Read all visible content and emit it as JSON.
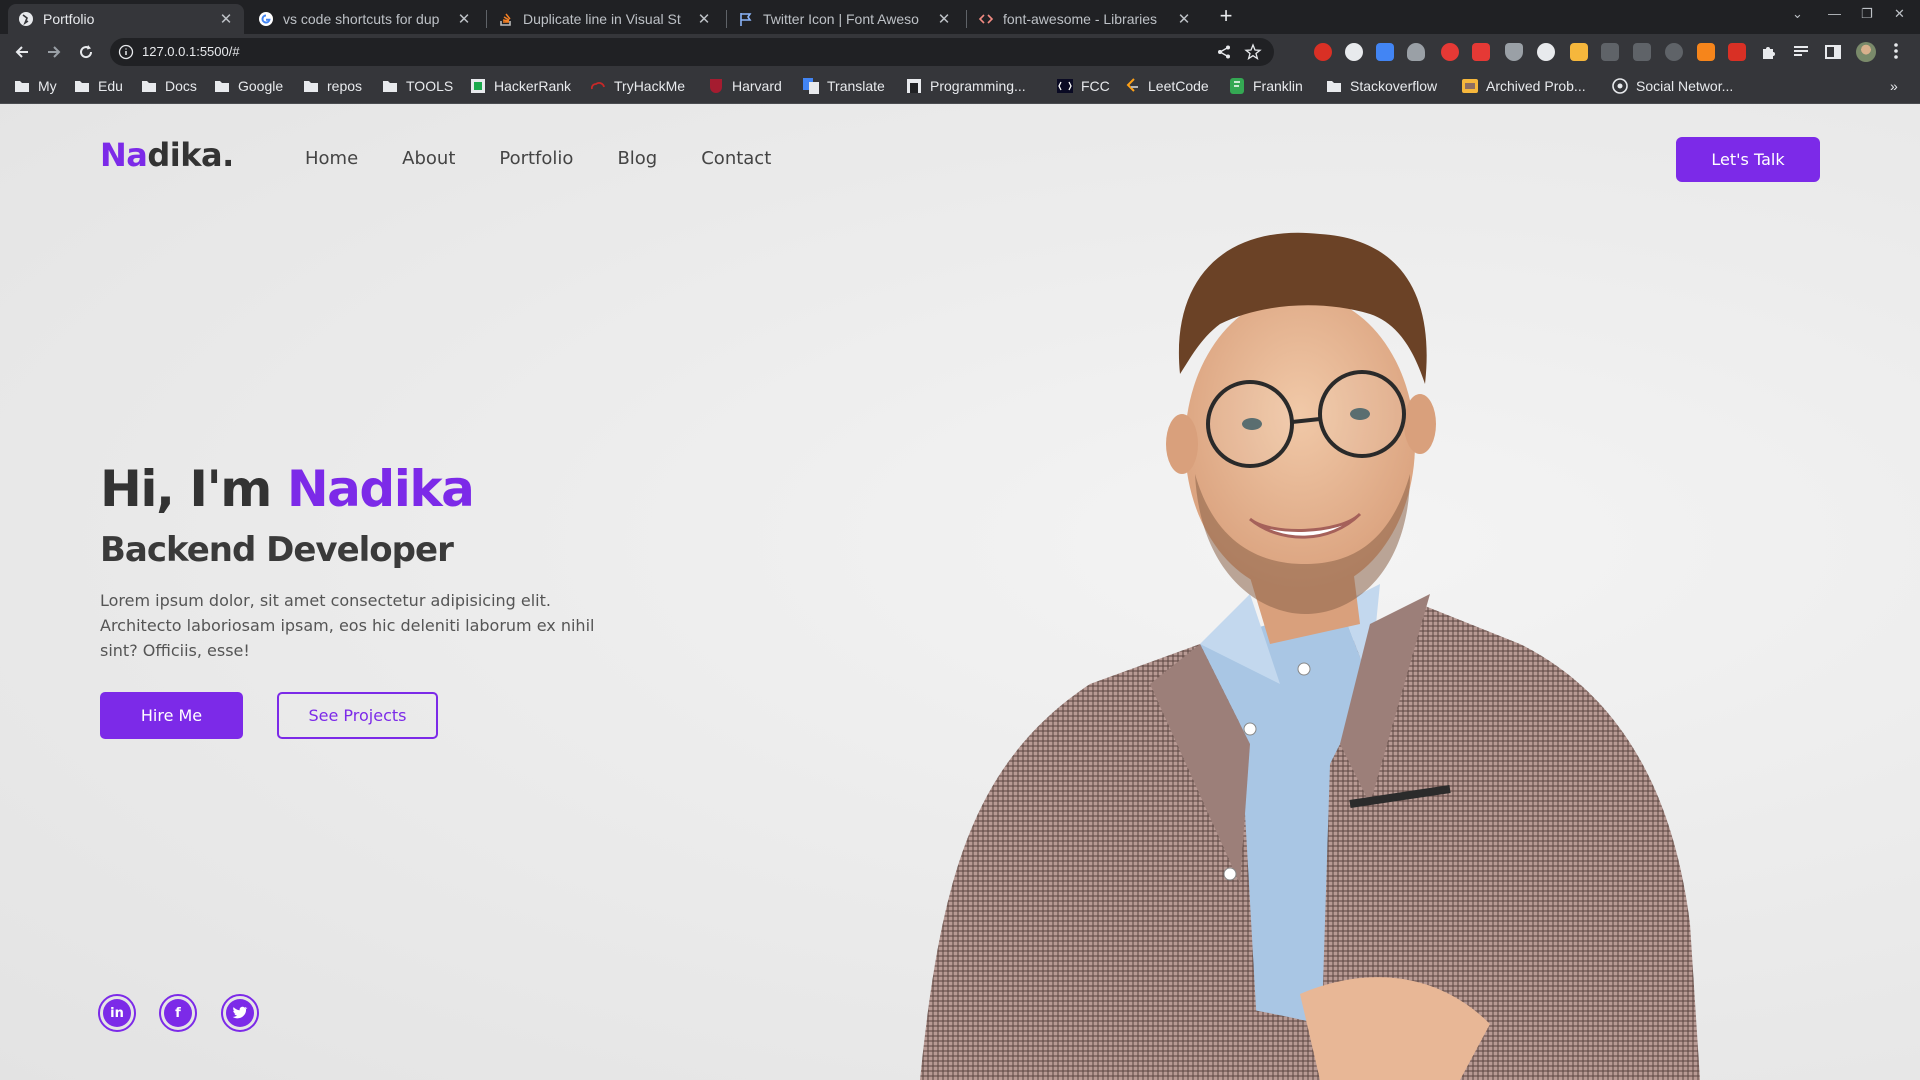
{
  "browser": {
    "tabs": [
      {
        "title": "Portfolio",
        "active": true
      },
      {
        "title": "vs code shortcuts for dup",
        "active": false
      },
      {
        "title": "Duplicate line in Visual St",
        "active": false
      },
      {
        "title": "Twitter Icon | Font Aweso",
        "active": false
      },
      {
        "title": "font-awesome - Libraries",
        "active": false
      }
    ],
    "url": "127.0.0.1:5500/#",
    "bookmarks": [
      "My",
      "Edu",
      "Docs",
      "Google",
      "repos",
      "TOOLS",
      "HackerRank",
      "TryHackMe",
      "Harvard",
      "Translate",
      "Programming...",
      "FCC",
      "LeetCode",
      "Franklin",
      "Stackoverflow",
      "Archived Prob...",
      "Social Networ..."
    ],
    "bookmarks_more": "»"
  },
  "page": {
    "logo": {
      "accent": "Na",
      "rest": "dika."
    },
    "nav": [
      "Home",
      "About",
      "Portfolio",
      "Blog",
      "Contact"
    ],
    "cta": "Let's Talk",
    "hero": {
      "greeting": "Hi, I'm ",
      "name": "Nadika",
      "role": "Backend Developer",
      "description": "Lorem ipsum dolor, sit amet consectetur adipisicing elit. Architecto laboriosam ipsam, eos hic deleniti laborum ex nihil sint? Officiis, esse!",
      "primary_button": "Hire Me",
      "secondary_button": "See Projects"
    },
    "social": [
      {
        "icon": "linkedin-icon",
        "glyph": "in"
      },
      {
        "icon": "facebook-icon",
        "glyph": "f"
      },
      {
        "icon": "twitter-icon",
        "glyph": ""
      }
    ],
    "colors": {
      "accent": "#7c2ae8",
      "text": "#333333",
      "background": "#ececec"
    }
  }
}
